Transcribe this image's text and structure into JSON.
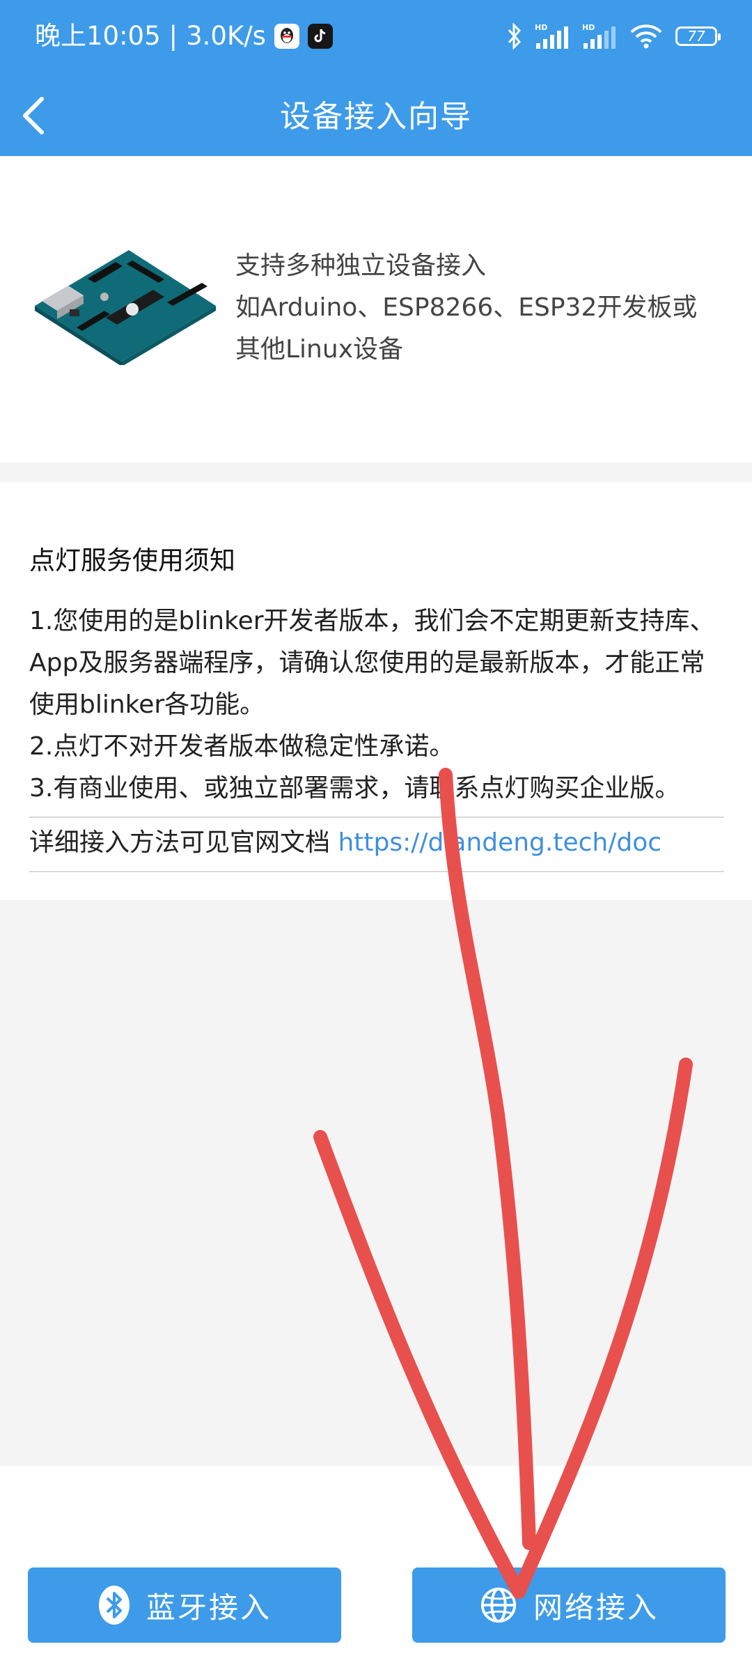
{
  "status_bar": {
    "time": "晚上10:05",
    "separator": "|",
    "speed": "3.0K/s",
    "battery": "77"
  },
  "header": {
    "title": "设备接入向导"
  },
  "intro": {
    "line1": "支持多种独立设备接入",
    "line2": "如Arduino、ESP8266、ESP32开发板或",
    "line3": "其他Linux设备"
  },
  "notice": {
    "title": "点灯服务使用须知",
    "lines": [
      "1.您使用的是blinker开发者版本，我们会不定期更新支持库、App及服务器端程序，请确认您使用的是最新版本，才能正常使用blinker各功能。",
      "2.点灯不对开发者版本做稳定性承诺。",
      "3.有商业使用、或独立部署需求，请联系点灯购买企业版。"
    ],
    "doc_label": "详细接入方法可见官网文档",
    "doc_link": "https://diandeng.tech/doc"
  },
  "buttons": {
    "bluetooth": "蓝牙接入",
    "network": "网络接入"
  },
  "colors": {
    "primary": "#3d9be9",
    "link": "#3d8fe0",
    "annotation": "#e8504e"
  },
  "icons": [
    "qq-icon",
    "tiktok-icon",
    "bluetooth-icon",
    "signal-icon",
    "wifi-icon",
    "battery-icon",
    "back-icon",
    "globe-icon"
  ]
}
